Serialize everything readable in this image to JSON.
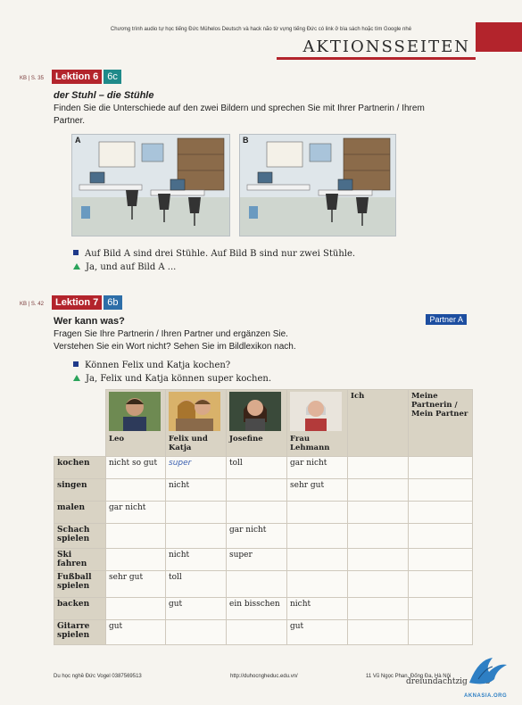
{
  "watermark": "Chương trình audio tự học tiếng Đức Mühelos Deutsch và hack não từ vựng tiếng Đức có link ở bìa sách hoặc tìm Google nhé",
  "page_title": "AKTIONSSEITEN",
  "section1": {
    "ref": "KB | S. 35",
    "lektion": "Lektion 6",
    "sub": "6c",
    "title": "der Stuhl – die Stühle",
    "instruction": "Finden Sie die Unterschiede auf den zwei Bildern und sprechen Sie mit Ihrer Partnerin / Ihrem Partner.",
    "image_a_label": "A",
    "image_b_label": "B",
    "line_a": "Auf Bild A sind drei Stühle. Auf Bild B sind nur zwei Stühle.",
    "line_b": "Ja, und auf Bild A ..."
  },
  "section2": {
    "ref": "KB | S. 42",
    "lektion": "Lektion 7",
    "sub": "6b",
    "partner": "Partner A",
    "title": "Wer kann was?",
    "instruction1": "Fragen Sie Ihre Partnerin / Ihren Partner und ergänzen Sie.",
    "instruction2": "Verstehen Sie ein Wort nicht? Sehen Sie im Bildlexikon nach.",
    "line_a": "Können Felix und Katja kochen?",
    "line_b": "Ja, Felix und Katja können super kochen."
  },
  "table": {
    "columns": [
      "Leo",
      "Felix und Katja",
      "Josefine",
      "Frau Lehmann",
      "Ich",
      "Meine Partnerin / Mein Partner"
    ],
    "rows": [
      {
        "label": "kochen",
        "cells": [
          "nicht so gut",
          "super",
          "toll",
          "gar nicht",
          "",
          ""
        ]
      },
      {
        "label": "singen",
        "cells": [
          "",
          "nicht",
          "",
          "sehr gut",
          "",
          ""
        ]
      },
      {
        "label": "malen",
        "cells": [
          "gar nicht",
          "",
          "",
          "",
          "",
          ""
        ]
      },
      {
        "label": "Schach spielen",
        "cells": [
          "",
          "",
          "gar nicht",
          "",
          "",
          ""
        ]
      },
      {
        "label": "Ski fahren",
        "cells": [
          "",
          "nicht",
          "super",
          "",
          "",
          ""
        ]
      },
      {
        "label": "Fußball spielen",
        "cells": [
          "sehr gut",
          "toll",
          "",
          "",
          "",
          ""
        ]
      },
      {
        "label": "backen",
        "cells": [
          "",
          "gut",
          "ein bisschen",
          "nicht",
          "",
          ""
        ]
      },
      {
        "label": "Gitarre spielen",
        "cells": [
          "gut",
          "",
          "",
          "gut",
          "",
          ""
        ]
      }
    ]
  },
  "footer": {
    "left": "Du học nghề Đức Vogel 0387569513",
    "center": "http://duhocngheduc.edu.vn/",
    "right": "11 Vũ Ngọc Phan, Đống Đa, Hà Nội",
    "page_word": "dreiundachtzig",
    "page_num": "83",
    "site": "AKNASIA.ORG"
  },
  "colors": {
    "red": "#b3242c",
    "teal": "#1f8a8a",
    "blue": "#1d4ea0",
    "green": "#2aa35a"
  }
}
